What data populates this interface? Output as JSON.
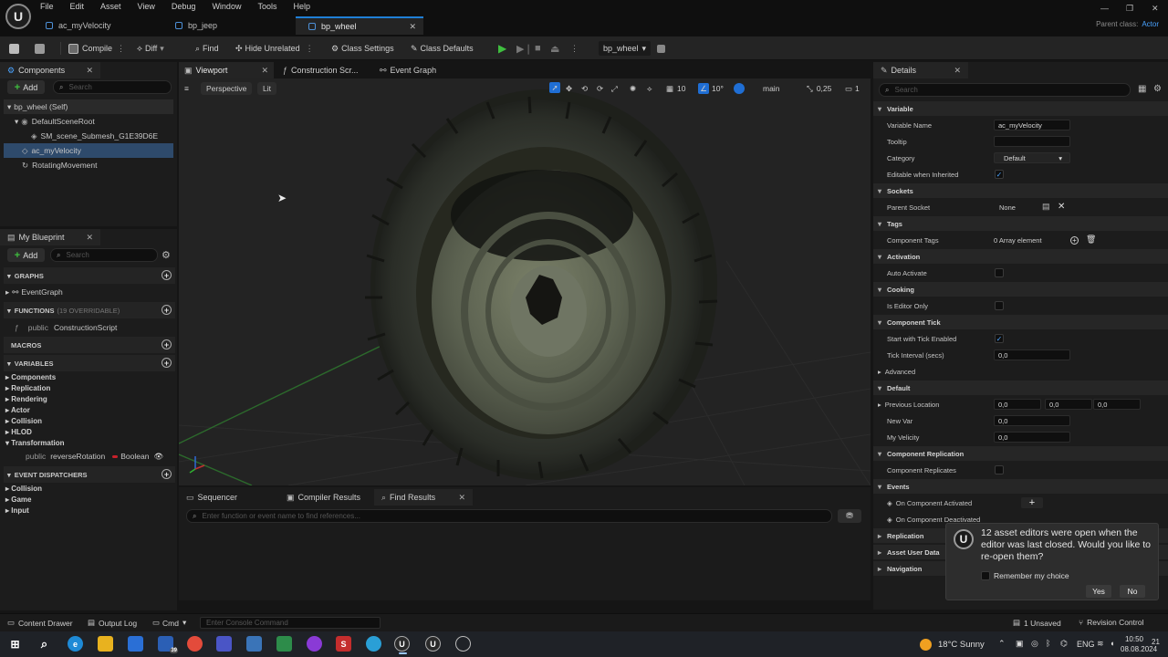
{
  "menu": [
    "File",
    "Edit",
    "Asset",
    "View",
    "Debug",
    "Window",
    "Tools",
    "Help"
  ],
  "doc_tabs": [
    {
      "label": "ac_myVelocity"
    },
    {
      "label": "bp_jeep"
    },
    {
      "label": "bp_wheel"
    }
  ],
  "parent_class": {
    "label": "Parent class:",
    "value": "Actor"
  },
  "toolbar": {
    "compile": "Compile",
    "diff": "Diff",
    "find": "Find",
    "hide_unrelated": "Hide Unrelated",
    "class_settings": "Class Settings",
    "class_defaults": "Class Defaults",
    "debug_object": "bp_wheel"
  },
  "components_panel": {
    "tab": "Components",
    "add": "Add",
    "search_placeholder": "Search",
    "items": [
      "bp_wheel (Self)",
      "DefaultSceneRoot",
      "SM_scene_Submesh_G1E39D6E",
      "ac_myVelocity",
      "RotatingMovement"
    ]
  },
  "my_blueprint": {
    "tab": "My Blueprint",
    "add": "Add",
    "search_placeholder": "Search",
    "graphs_head": "GRAPHS",
    "graph_item": "EventGraph",
    "functions_head": "FUNCTIONS",
    "functions_sub": "(19 OVERRIDABLE)",
    "function_access": "public",
    "function_item": "ConstructionScript",
    "macros_head": "MACROS",
    "variables_head": "VARIABLES",
    "variable_cats": [
      "Components",
      "Replication",
      "Rendering",
      "Actor",
      "Collision",
      "HLOD",
      "Transformation"
    ],
    "var_access": "public",
    "var_name": "reverseRotation",
    "var_type": "Boolean",
    "dispatchers_head": "EVENT DISPATCHERS",
    "dispatcher_cats": [
      "Collision",
      "Game",
      "Input"
    ]
  },
  "editor_tabs": [
    "Viewport",
    "Construction Scr...",
    "Event Graph"
  ],
  "viewport": {
    "perspective": "Perspective",
    "lit": "Lit",
    "grid": "10",
    "angle": "10°",
    "camera": "main",
    "scale": "0,25",
    "cams": "1"
  },
  "bottom_tabs": [
    "Sequencer",
    "Compiler Results",
    "Find Results"
  ],
  "find_placeholder": "Enter function or event name to find references...",
  "details": {
    "tab": "Details",
    "search_placeholder": "Search",
    "sections": {
      "variable": "Variable",
      "sockets": "Sockets",
      "tags": "Tags",
      "activation": "Activation",
      "cooking": "Cooking",
      "component_tick": "Component Tick",
      "default": "Default",
      "component_replication": "Component Replication",
      "events": "Events",
      "replication": "Replication",
      "asset_user_data": "Asset User Data",
      "navigation": "Navigation"
    },
    "rows": {
      "variable_name": {
        "label": "Variable Name",
        "value": "ac_myVelocity"
      },
      "tooltip": {
        "label": "Tooltip",
        "value": ""
      },
      "category": {
        "label": "Category",
        "value": "Default"
      },
      "editable_inherited": {
        "label": "Editable when Inherited"
      },
      "parent_socket": {
        "label": "Parent Socket",
        "value": "None"
      },
      "component_tags": {
        "label": "Component Tags",
        "value": "0 Array element"
      },
      "auto_activate": {
        "label": "Auto Activate"
      },
      "is_editor_only": {
        "label": "Is Editor Only"
      },
      "start_tick": {
        "label": "Start with Tick Enabled"
      },
      "tick_interval": {
        "label": "Tick Interval (secs)",
        "value": "0,0"
      },
      "advanced": {
        "label": "Advanced"
      },
      "previous_location": {
        "label": "Previous Location",
        "x": "0,0",
        "y": "0,0",
        "z": "0,0"
      },
      "new_var": {
        "label": "New Var",
        "value": "0,0"
      },
      "my_velicity": {
        "label": "My Velicity",
        "value": "0,0"
      },
      "component_replicates": {
        "label": "Component Replicates"
      },
      "on_activated": {
        "label": "On Component Activated"
      },
      "on_deactivated": {
        "label": "On Component Deactivated"
      }
    }
  },
  "notification": {
    "message": "12 asset editors were open when the editor was last closed. Would you like to re-open them?",
    "remember": "Remember my choice",
    "yes": "Yes",
    "no": "No"
  },
  "statusbar": {
    "content_drawer": "Content Drawer",
    "output_log": "Output Log",
    "cmd": "Cmd",
    "console_placeholder": "Enter Console Command",
    "unsaved": "1 Unsaved",
    "revision": "Revision Control"
  },
  "taskbar": {
    "weather": "18°C  Sunny",
    "lang": "ENG",
    "time": "10:50",
    "date": "08.08.2024",
    "notif_count": "21",
    "mail_badge": "39"
  }
}
